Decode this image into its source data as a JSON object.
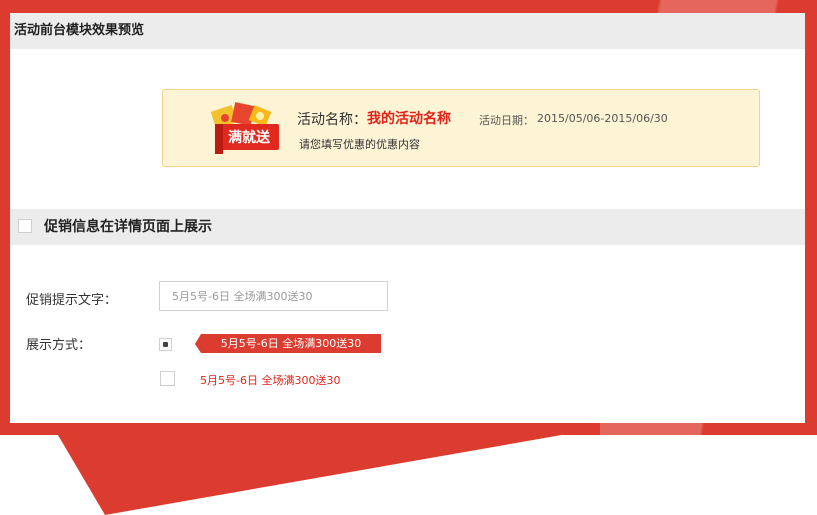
{
  "header": {
    "title": "活动前台模块效果预览"
  },
  "preview": {
    "badge_text": "满就送",
    "name_label": "活动名称：",
    "name_value": "我的活动名称",
    "date_label": "活动日期：",
    "date_value": "2015/05/06-2015/06/30",
    "description": "请您填写优惠的优惠内容"
  },
  "promo_section": {
    "title": "促销信息在详情页面上展示",
    "checked": false
  },
  "form": {
    "tip_label": "促销提示文字：",
    "tip_value": "5月5号-6日 全场满300送30",
    "mode_label": "展示方式：",
    "option_tag_text": "5月5号-6日 全场满300送30",
    "option_text_text": "5月5号-6日 全场满300送30",
    "selected_option": "tag"
  },
  "colors": {
    "accent_red": "#dc3b2f",
    "text_red": "#e2231a",
    "card_bg": "#fdf3d5"
  }
}
